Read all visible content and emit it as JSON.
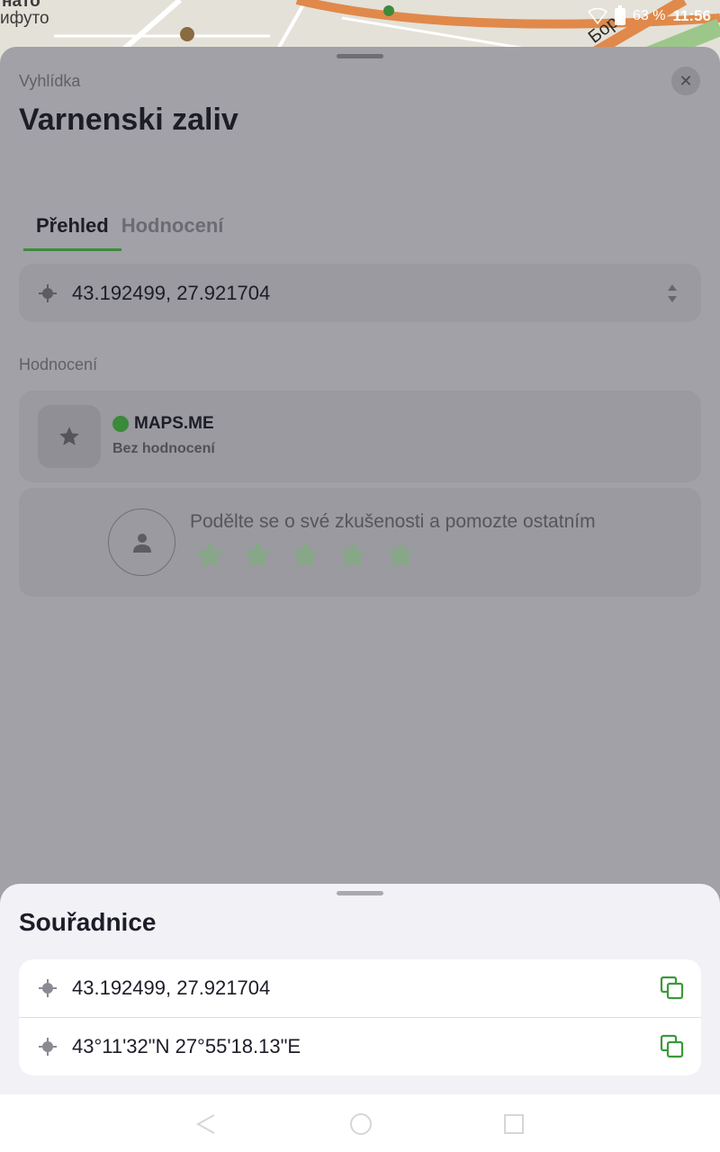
{
  "map": {
    "label_top": "нато",
    "label_district": "ифуто",
    "road_label": "Бор"
  },
  "status_bar": {
    "battery": "63 %",
    "time": "11:56"
  },
  "place": {
    "subtitle": "Vyhlídka",
    "title": "Varnenski zaliv",
    "close_icon": "close-icon",
    "tabs": [
      {
        "label": "Přehled",
        "active": true
      },
      {
        "label": "Hodnocení",
        "active": false
      }
    ],
    "coordinates": "43.192499, 27.921704",
    "ratings_section_label": "Hodnocení",
    "rating_source": "MAPS.ME",
    "rating_value": "Bez hodnocení",
    "review_prompt": "Podělte se o své zkušenosti a pomozte ostatním",
    "star_count": 5
  },
  "coordinates_sheet": {
    "title": "Souřadnice",
    "items": [
      {
        "value": "43.192499, 27.921704",
        "icon": "copy-icon"
      },
      {
        "value": "43°11'32\"N 27°55'18.13\"E",
        "icon": "copy-icon"
      }
    ]
  },
  "colors": {
    "accent": "#3a9a3a",
    "text_primary": "#1d1d28",
    "sheet_bg": "#f1f1f6",
    "scrim": "#9a9aa0"
  }
}
